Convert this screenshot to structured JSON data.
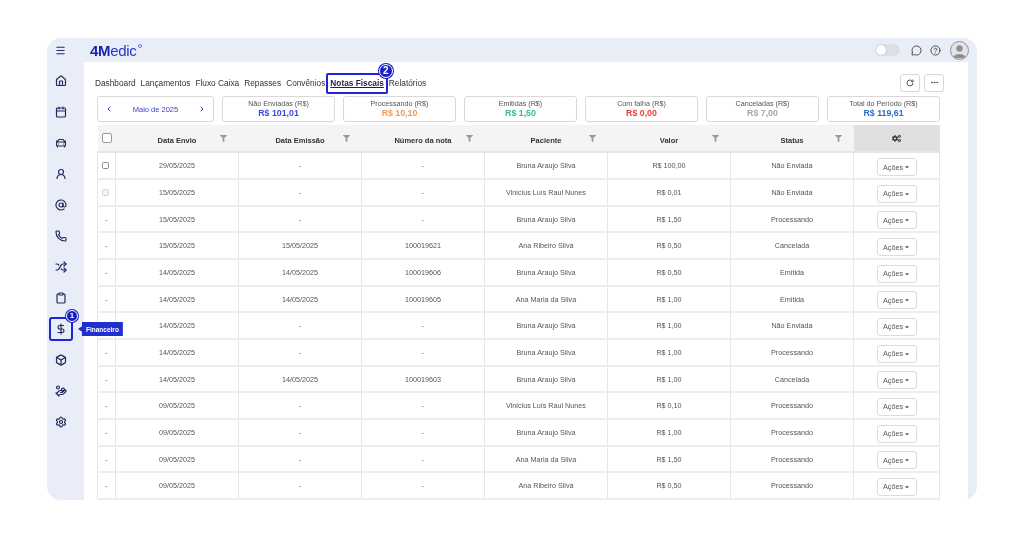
{
  "header": {
    "logo": "**4M**edic",
    "theme_toggle": {
      "on": false
    }
  },
  "sidebar": {
    "items": [
      {
        "kind": "home",
        "highlighted": false
      },
      {
        "kind": "calendar",
        "highlighted": false
      },
      {
        "kind": "car",
        "highlighted": false
      },
      {
        "kind": "user",
        "highlighted": false
      },
      {
        "kind": "at",
        "highlighted": false
      },
      {
        "kind": "phone",
        "highlighted": false
      },
      {
        "kind": "shuffle",
        "highlighted": false
      },
      {
        "kind": "clipboard",
        "highlighted": false
      },
      {
        "kind": "dollar",
        "highlighted": true,
        "callout": "1",
        "tooltip": "Financeiro"
      },
      {
        "kind": "cube",
        "highlighted": false
      },
      {
        "kind": "chart",
        "highlighted": false
      },
      {
        "kind": "settings",
        "highlighted": false
      }
    ]
  },
  "nav": {
    "tabs": [
      {
        "label": "Dashboard",
        "selected": false,
        "highlighted": false
      },
      {
        "label": "Lançamentos",
        "selected": false,
        "highlighted": false
      },
      {
        "label": "Fluxo Caixa",
        "selected": false,
        "highlighted": false
      },
      {
        "label": "Repasses",
        "selected": false,
        "highlighted": false
      },
      {
        "label": "Convênios",
        "selected": false,
        "highlighted": false
      },
      {
        "label": "Notas Fiscais",
        "selected": true,
        "highlighted": true,
        "callout": "2"
      },
      {
        "label": "Relatórios",
        "selected": false,
        "highlighted": false
      }
    ]
  },
  "period": {
    "label": "Maio de 2025"
  },
  "summary": {
    "cards": [
      {
        "label": "Não Enviadas (R$)",
        "value": "R$ 101,01",
        "color": "#3b4bd8"
      },
      {
        "label": "Processando (R$)",
        "value": "R$ 10,10",
        "color": "#f09a58"
      },
      {
        "label": "Emitidas (R$)",
        "value": "R$ 1,50",
        "color": "#36b9a4"
      },
      {
        "label": "Com falha (R$)",
        "value": "R$ 0,00",
        "color": "#f23c3c"
      },
      {
        "label": "Canceladas (R$)",
        "value": "R$ 7,00",
        "color": "#a6a6a6"
      },
      {
        "label": "Total do Período (R$)",
        "value": "R$ 119,61",
        "color": "#2f6cc0"
      }
    ]
  },
  "table": {
    "select_all": {
      "checked": false
    },
    "columns": [
      "Data Envio",
      "Data Emissão",
      "Número da nota",
      "Paciente",
      "Valor",
      "Status"
    ],
    "rows": [
      {
        "select": {
          "kind": "checkbox",
          "checked": false,
          "disabled": false
        },
        "cells": [
          "29/05/2025",
          "-",
          "-",
          "Bruna Araujo Silva",
          "R$ 100,00",
          "Não Enviada"
        ],
        "action": "Ações"
      },
      {
        "select": {
          "kind": "checkbox",
          "checked": false,
          "disabled": true
        },
        "cells": [
          "15/05/2025",
          "-",
          "-",
          "Vinicius Luís Raul Nunes",
          "R$ 0,01",
          "Não Enviada"
        ],
        "action": "Ações"
      },
      {
        "select": {
          "kind": "text",
          "text": "-"
        },
        "cells": [
          "15/05/2025",
          "-",
          "-",
          "Bruna Araujo Silva",
          "R$ 1,50",
          "Processando"
        ],
        "action": "Ações"
      },
      {
        "select": {
          "kind": "text",
          "text": "-"
        },
        "cells": [
          "15/05/2025",
          "15/05/2025",
          "100019621",
          "Ana Ribeiro Silva",
          "R$ 0,50",
          "Cancelada"
        ],
        "action": "Ações"
      },
      {
        "select": {
          "kind": "text",
          "text": "-"
        },
        "cells": [
          "14/05/2025",
          "14/05/2025",
          "100019606",
          "Bruna Araujo Silva",
          "R$ 0,50",
          "Emitida"
        ],
        "action": "Ações"
      },
      {
        "select": {
          "kind": "text",
          "text": "-"
        },
        "cells": [
          "14/05/2025",
          "14/05/2025",
          "100019605",
          "Ana Maria da Silva",
          "R$ 1,00",
          "Emitida"
        ],
        "action": "Ações"
      },
      {
        "cells": [
          "14/05/2025",
          "-",
          "-",
          "Bruna Araujo Silva",
          "R$ 1,00",
          "Não Enviada"
        ],
        "action": "Ações"
      },
      {
        "select": {
          "kind": "text",
          "text": "-"
        },
        "cells": [
          "14/05/2025",
          "-",
          "-",
          "Bruna Araujo Silva",
          "R$ 1,00",
          "Processando"
        ],
        "action": "Ações"
      },
      {
        "select": {
          "kind": "text",
          "text": "-"
        },
        "cells": [
          "14/05/2025",
          "14/05/2025",
          "100019603",
          "Bruna Araujo Silva",
          "R$ 1,00",
          "Cancelada"
        ],
        "action": "Ações"
      },
      {
        "select": {
          "kind": "text",
          "text": "-"
        },
        "cells": [
          "09/05/2025",
          "-",
          "-",
          "Vinicius Luís Raul Nunes",
          "R$ 0,10",
          "Processando"
        ],
        "action": "Ações"
      },
      {
        "select": {
          "kind": "text",
          "text": "-"
        },
        "cells": [
          "09/05/2025",
          "-",
          "-",
          "Bruna Araujo Silva",
          "R$ 1,00",
          "Processando"
        ],
        "action": "Ações"
      },
      {
        "select": {
          "kind": "text",
          "text": "-"
        },
        "cells": [
          "09/05/2025",
          "-",
          "-",
          "Ana Maria da Silva",
          "R$ 1,50",
          "Processando"
        ],
        "action": "Ações"
      },
      {
        "select": {
          "kind": "text",
          "text": "-"
        },
        "cells": [
          "09/05/2025",
          "-",
          "-",
          "Ana Ribeiro Silva",
          "R$ 0,50",
          "Processando"
        ],
        "action": "Ações"
      }
    ]
  }
}
